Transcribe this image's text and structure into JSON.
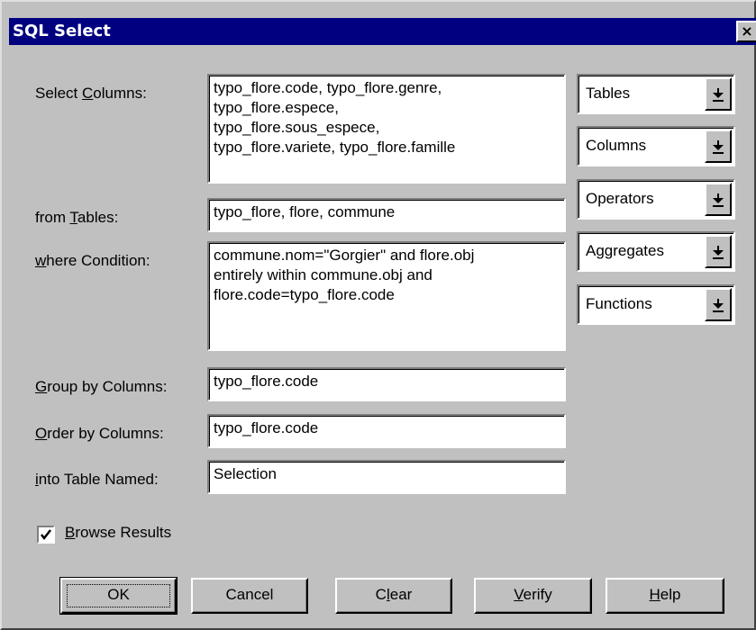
{
  "window": {
    "title": "SQL Select",
    "close_glyph": "×"
  },
  "labels": {
    "select_pre": "Select ",
    "select_key": "C",
    "select_post": "olumns:",
    "from_pre": "from ",
    "from_key": "T",
    "from_post": "ables:",
    "where_key": "w",
    "where_post": "here Condition:",
    "group_key": "G",
    "group_post": "roup by Columns:",
    "order_key": "O",
    "order_post": "rder by Columns:",
    "into_key": "i",
    "into_post": "nto Table Named:"
  },
  "fields": {
    "select_columns": "typo_flore.code, typo_flore.genre,\ntypo_flore.espece,\ntypo_flore.sous_espece,\ntypo_flore.variete, typo_flore.famille",
    "from_tables": "typo_flore, flore, commune",
    "where_condition": "commune.nom=\"Gorgier\" and flore.obj\nentirely within commune.obj and\nflore.code=typo_flore.code",
    "group_by": "typo_flore.code",
    "order_by": "typo_flore.code",
    "into_table": "Selection"
  },
  "dropdowns": {
    "tables": "Tables",
    "columns": "Columns",
    "operators": "Operators",
    "aggregates": "Aggregates",
    "functions": "Functions"
  },
  "browse_results": {
    "checked": true,
    "key": "B",
    "post": "rowse Results"
  },
  "buttons": {
    "ok": "OK",
    "cancel": "Cancel",
    "clear_pre": "C",
    "clear_key": "l",
    "clear_post": "ear",
    "verify_key": "V",
    "verify_post": "erify",
    "help_key": "H",
    "help_post": "elp"
  }
}
